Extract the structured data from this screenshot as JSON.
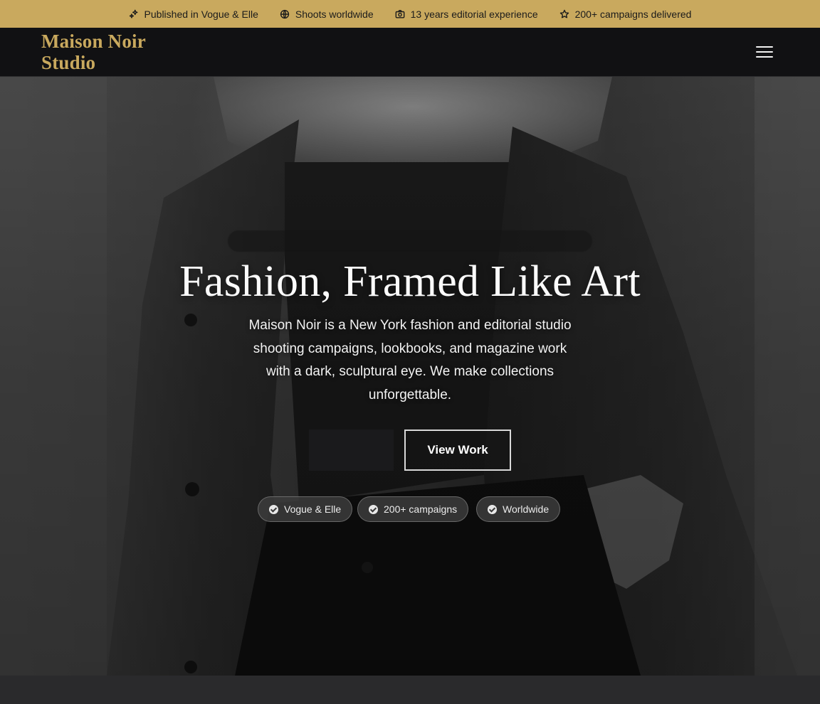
{
  "topbar": {
    "items": [
      {
        "label": "Published in Vogue & Elle",
        "icon": "sparkles-icon"
      },
      {
        "label": "Shoots worldwide",
        "icon": "globe-icon"
      },
      {
        "label": "13 years editorial experience",
        "icon": "camera-icon"
      },
      {
        "label": "200+ campaigns delivered",
        "icon": "star-icon"
      }
    ]
  },
  "header": {
    "logo_line1": "Maison Noir",
    "logo_line2": "Studio",
    "menu_icon": "hamburger-menu-icon"
  },
  "hero": {
    "title": "Fashion, Framed Like Art",
    "description": "Maison Noir is a New York fashion and editorial studio shooting campaigns, lookbooks, and magazine work with a dark, sculptural eye. We make collections unforgettable.",
    "secondary_cta": "View Work",
    "badges": [
      "Vogue & Elle",
      "200+ campaigns",
      "Worldwide"
    ]
  },
  "colors": {
    "accent_gold": "#c9a95e",
    "header_bg": "#111113",
    "hero_text": "#fbfbfb"
  }
}
